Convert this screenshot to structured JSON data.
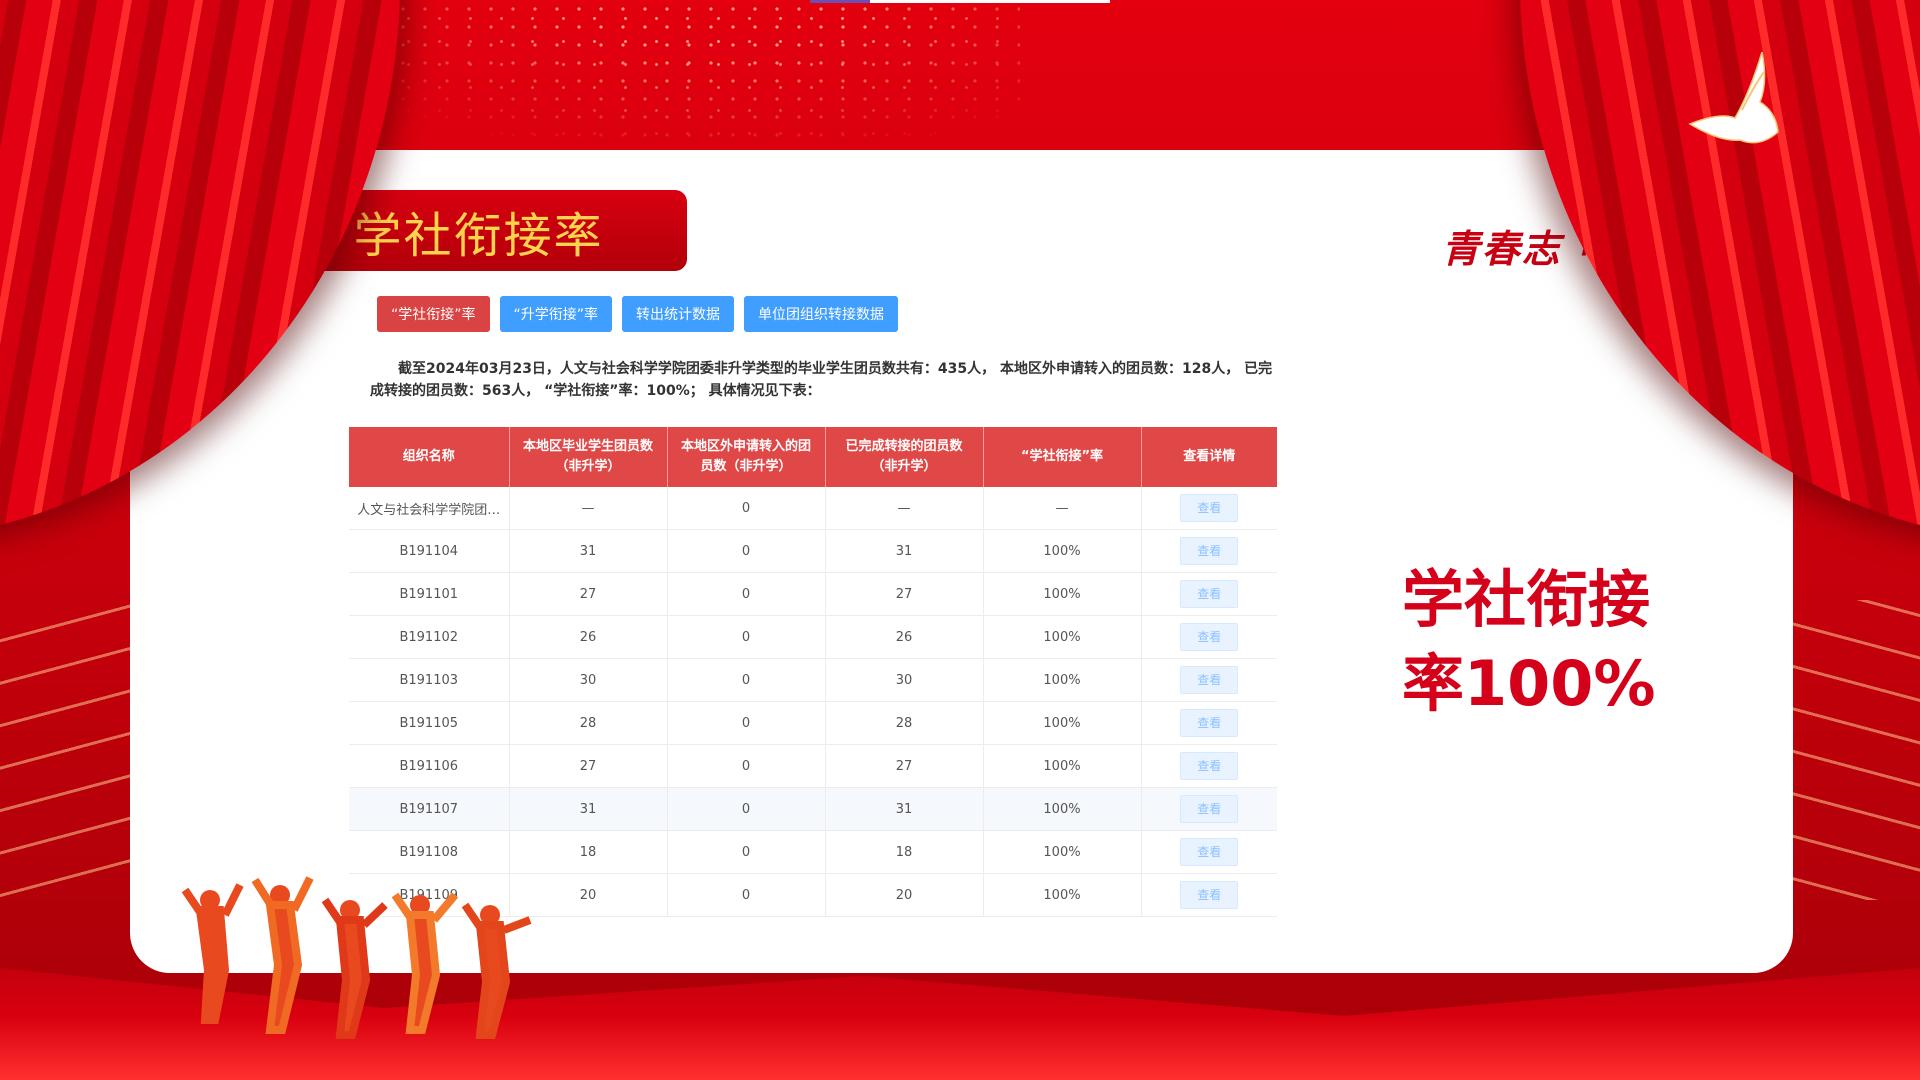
{
  "title": "学社衔接率",
  "slogan": "青春志 中国梦",
  "tabs": [
    {
      "label": "“学社衔接”率",
      "active": true
    },
    {
      "label": "“升学衔接”率",
      "active": false
    },
    {
      "label": "转出统计数据",
      "active": false
    },
    {
      "label": "单位团组织转接数据",
      "active": false
    }
  ],
  "summary": "截至2024年03月23日，人文与社会科学学院团委非升学类型的毕业学生团员数共有：435人， 本地区外申请转入的团员数：128人， 已完成转接的团员数：563人， “学社衔接”率：100%； 具体情况见下表：",
  "table": {
    "headers": [
      "组织名称",
      "本地区毕业学生团员数（非升学）",
      "本地区外申请转入的团员数（非升学）",
      "已完成转接的团员数（非升学）",
      "“学社衔接”率",
      "查看详情"
    ],
    "view_label": "查看",
    "rows": [
      [
        "人文与社会科学学院团…",
        "—",
        "0",
        "—",
        "—"
      ],
      [
        "B191104",
        "31",
        "0",
        "31",
        "100%"
      ],
      [
        "B191101",
        "27",
        "0",
        "27",
        "100%"
      ],
      [
        "B191102",
        "26",
        "0",
        "26",
        "100%"
      ],
      [
        "B191103",
        "30",
        "0",
        "30",
        "100%"
      ],
      [
        "B191105",
        "28",
        "0",
        "28",
        "100%"
      ],
      [
        "B191106",
        "27",
        "0",
        "27",
        "100%"
      ],
      [
        "B191107",
        "31",
        "0",
        "31",
        "100%"
      ],
      [
        "B191108",
        "18",
        "0",
        "18",
        "100%"
      ],
      [
        "B191109",
        "20",
        "0",
        "20",
        "100%"
      ]
    ],
    "highlighted_row": 7
  },
  "big_rate": {
    "line1": "学社衔接",
    "line2": "率100%"
  },
  "colors": {
    "accent_red": "#d94343",
    "tab_blue": "#409eff",
    "title_gold": "#ffd34d",
    "rate_red": "#d5001a"
  }
}
